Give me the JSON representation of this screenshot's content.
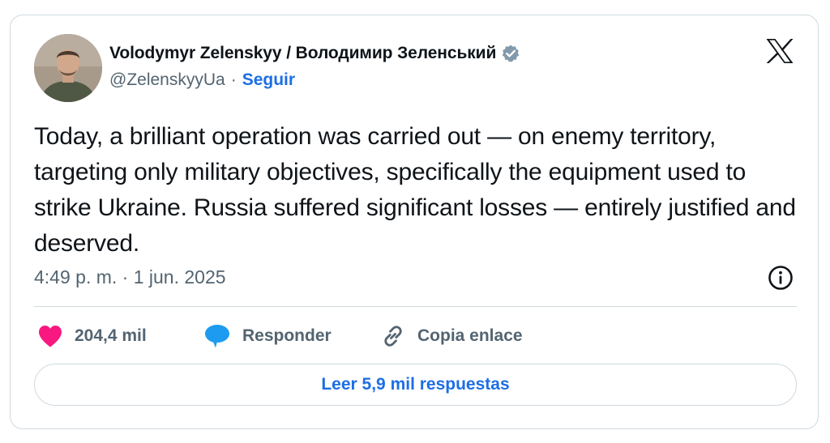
{
  "author": {
    "display_name": "Volodymyr Zelenskyy / Володимир Зеленський",
    "handle": "@ZelenskyyUa",
    "separator": "·",
    "follow_label": "Seguir",
    "verified": true
  },
  "tweet": {
    "text": "Today, a brilliant operation was carried out — on enemy territory, targeting only military objectives, specifically the equipment used to strike Ukraine. Russia suffered significant losses — entirely justified and deserved.",
    "timestamp": "4:49 p. m. · 1 jun. 2025"
  },
  "actions": {
    "like_count": "204,4 mil",
    "reply_label": "Responder",
    "copy_link_label": "Copia enlace"
  },
  "replies_button_label": "Leer 5,9 mil respuestas",
  "colors": {
    "like": "#f91880",
    "reply": "#1d9bf0",
    "link": "#1d6ee5",
    "secondary_text": "#536471",
    "verified_badge": "#829aab"
  },
  "icons": {
    "brand": "x-logo-icon",
    "verified": "verified-badge-icon",
    "info": "info-icon",
    "like": "heart-icon",
    "reply": "speech-bubble-icon",
    "copy_link": "link-icon"
  }
}
